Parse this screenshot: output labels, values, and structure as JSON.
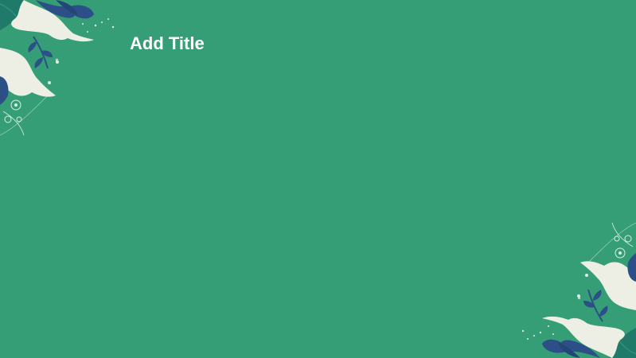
{
  "slide": {
    "title": "Add Title"
  },
  "colors": {
    "background": "#369e77",
    "cloud": "#eeefe4",
    "leaf_dark_blue": "#2b4f86",
    "leaf_teal": "#1f7a6a",
    "line_art": "#d8efe3",
    "title_text": "#ffffff"
  },
  "decorations": {
    "top_left": "floral-cloud-corner-decoration",
    "bottom_right": "floral-cloud-corner-decoration"
  }
}
